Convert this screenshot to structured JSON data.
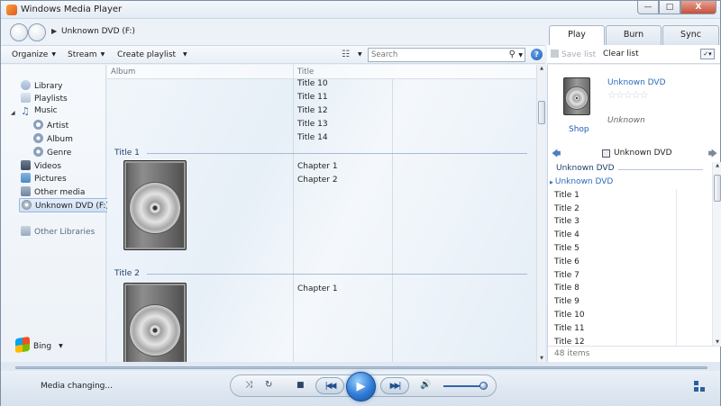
{
  "window": {
    "title": "Windows Media Player",
    "controls": {
      "minimize": "—",
      "maximize": "□",
      "close": "X"
    }
  },
  "nav": {
    "breadcrumb": "Unknown DVD (F:)"
  },
  "tabs": [
    {
      "label": "Play"
    },
    {
      "label": "Burn"
    },
    {
      "label": "Sync"
    }
  ],
  "toolbar": {
    "organize": "Organize",
    "stream": "Stream",
    "create_playlist": "Create playlist",
    "search_placeholder": "Search",
    "help": "?"
  },
  "list_toolbar": {
    "save_list": "Save list",
    "clear_list": "Clear list"
  },
  "sidebar": {
    "library": "Library",
    "playlists": "Playlists",
    "music": "Music",
    "artist": "Artist",
    "album": "Album",
    "genre": "Genre",
    "videos": "Videos",
    "pictures": "Pictures",
    "other_media": "Other media",
    "dvd": "Unknown DVD (F:)",
    "other_libraries": "Other Libraries",
    "bing": "Bing"
  },
  "columns": {
    "album": "Album",
    "title": "Title"
  },
  "content": {
    "top_titles": [
      "Title 10",
      "Title 11",
      "Title 12",
      "Title 13",
      "Title 14"
    ],
    "groups": [
      {
        "name": "Title 1",
        "chapters": [
          "Chapter 1",
          "Chapter 2"
        ]
      },
      {
        "name": "Title 2",
        "chapters": [
          "Chapter 1"
        ]
      }
    ]
  },
  "now_playing": {
    "album": "Unknown DVD",
    "rating_stars": 5,
    "rating_glyphs": "☆☆☆☆☆",
    "artist": "Unknown",
    "shop": "Shop",
    "nav_label": "Unknown DVD"
  },
  "playlist": {
    "header": "Unknown DVD",
    "current": "Unknown DVD",
    "items": [
      "Title 1",
      "Title 2",
      "Title 3",
      "Title 4",
      "Title 5",
      "Title 6",
      "Title 7",
      "Title 8",
      "Title 9",
      "Title 10",
      "Title 11",
      "Title 12"
    ],
    "count": "48 items"
  },
  "status": {
    "text": "Media changing..."
  },
  "colors": {
    "accent": "#2f7bd6",
    "link": "#2a6cbb",
    "group_header": "#1e3f6a"
  }
}
